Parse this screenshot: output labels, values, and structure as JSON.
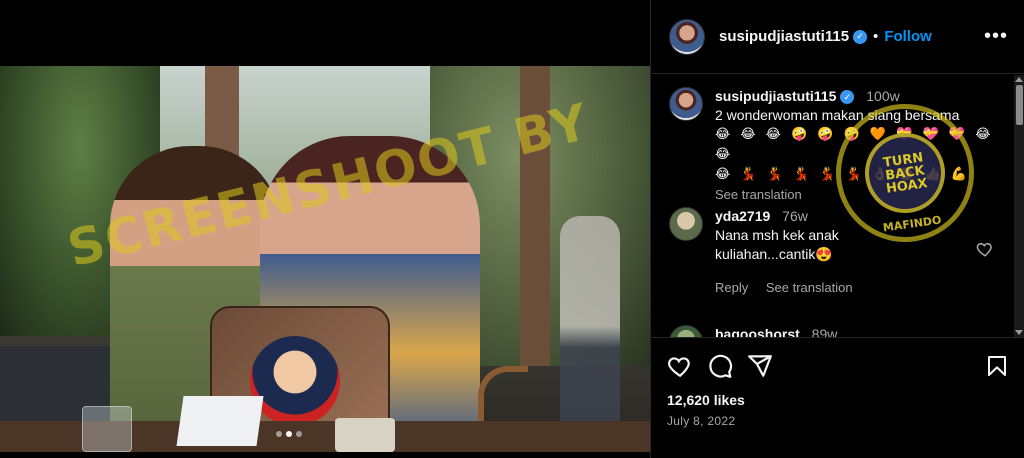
{
  "watermark": {
    "text": "SCREENSHOOT BY",
    "stamp_top": "MASYARAKAT ANTI FITNAH INDONESIA",
    "stamp_center": "TURN BACK HOAX",
    "stamp_bottom": "MAFINDO"
  },
  "post": {
    "carousel": {
      "count": 3,
      "active_index": 1
    },
    "header": {
      "username": "susipudjiastuti115",
      "separator": "•",
      "follow_label": "Follow",
      "more_label": "•••"
    },
    "comments": [
      {
        "username": "susipudjiastuti115",
        "age": "100w",
        "text": "2 wonderwoman makan siang bersama",
        "emoji_line1": "😂 😂 😂 🤪 🤪 🤪 🧡 💝 💝 💝 😂 😂",
        "emoji_line2": "😂 💃 💃 💃 💃 💃 👌 ✊ 👍 💪",
        "translation_label": "See translation"
      },
      {
        "username": "yda2719",
        "age": "76w",
        "text_line1": "Nana msh kek anak",
        "text_line2": "kuliahan...cantik😍",
        "reply_label": "Reply",
        "translation_label": "See translation"
      },
      {
        "username": "bagooshorst",
        "age": "89w"
      }
    ],
    "likes": "12,620 likes",
    "date": "July 8, 2022"
  },
  "colors": {
    "background": "#000000",
    "accent": "#0095f6",
    "watermark": "#dcc81e",
    "secondary_text": "#a8a8a8"
  }
}
